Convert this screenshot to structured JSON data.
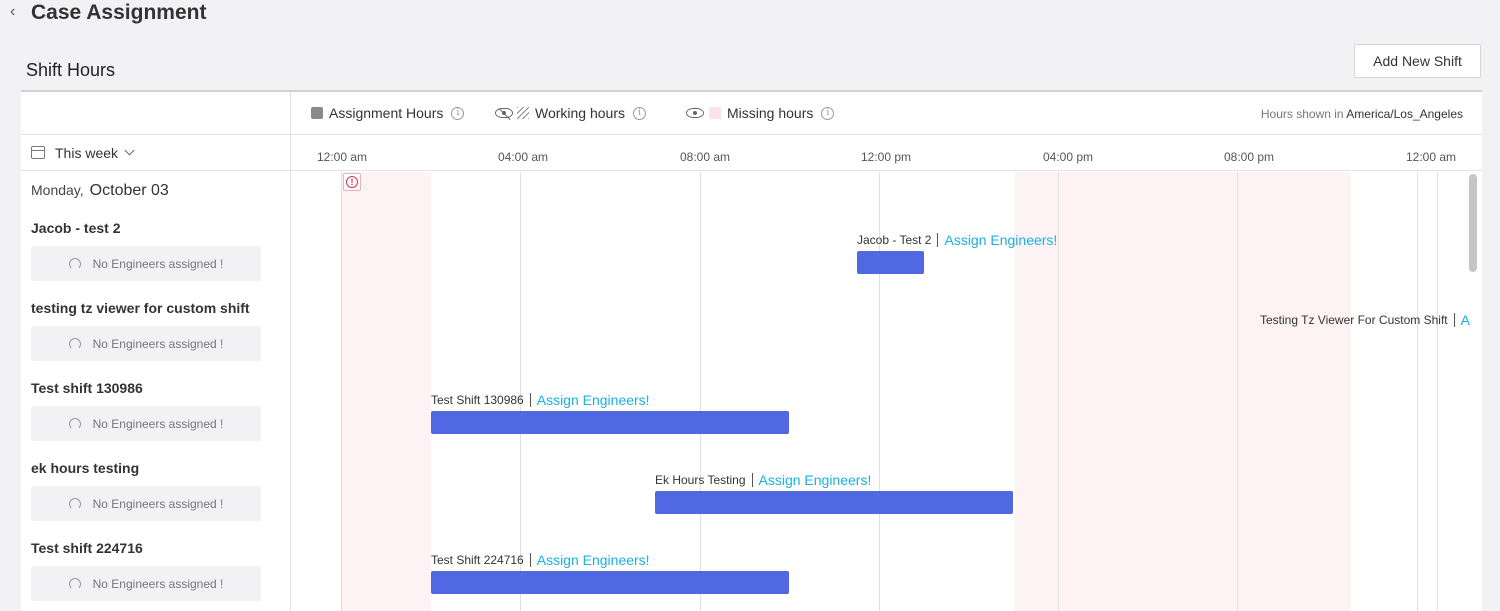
{
  "header": {
    "back_icon": "chevron-left-icon",
    "title": "Case Assignment"
  },
  "section": {
    "title": "Shift Hours",
    "add_button_label": "Add New Shift"
  },
  "legend": {
    "assignment_hours": "Assignment Hours",
    "working_hours": "Working hours",
    "missing_hours": "Missing hours",
    "info_glyph": "i",
    "timezone_prefix": "Hours shown in",
    "timezone": "America/Los_Angeles"
  },
  "filter": {
    "label": "This week"
  },
  "axis": {
    "ticks": [
      "12:00 am",
      "04:00 am",
      "08:00 am",
      "12:00 pm",
      "04:00 pm",
      "08:00 pm",
      "12:00 am"
    ]
  },
  "day": {
    "weekday": "Monday,",
    "date": "October 03"
  },
  "alert_glyph": "!",
  "shifts": [
    {
      "name": "Jacob - test 2",
      "engineers": "No Engineers assigned !",
      "bar_label": "Jacob - Test 2",
      "assign_label": "Assign Engineers!"
    },
    {
      "name": "testing tz viewer for custom shift",
      "engineers": "No Engineers assigned !",
      "bar_label": "Testing Tz Viewer For Custom Shift",
      "assign_label": "A"
    },
    {
      "name": "Test shift 130986",
      "engineers": "No Engineers assigned !",
      "bar_label": "Test Shift 130986",
      "assign_label": "Assign Engineers!"
    },
    {
      "name": "ek hours testing",
      "engineers": "No Engineers assigned !",
      "bar_label": "Ek Hours Testing",
      "assign_label": "Assign Engineers!"
    },
    {
      "name": "Test shift 224716",
      "engineers": "No Engineers assigned !",
      "bar_label": "Test Shift 224716",
      "assign_label": "Assign Engineers!"
    }
  ],
  "colors": {
    "bar": "#5168e3",
    "link": "#1bb0e0",
    "missing": "#fdf3f4",
    "alert": "#d0374f"
  }
}
